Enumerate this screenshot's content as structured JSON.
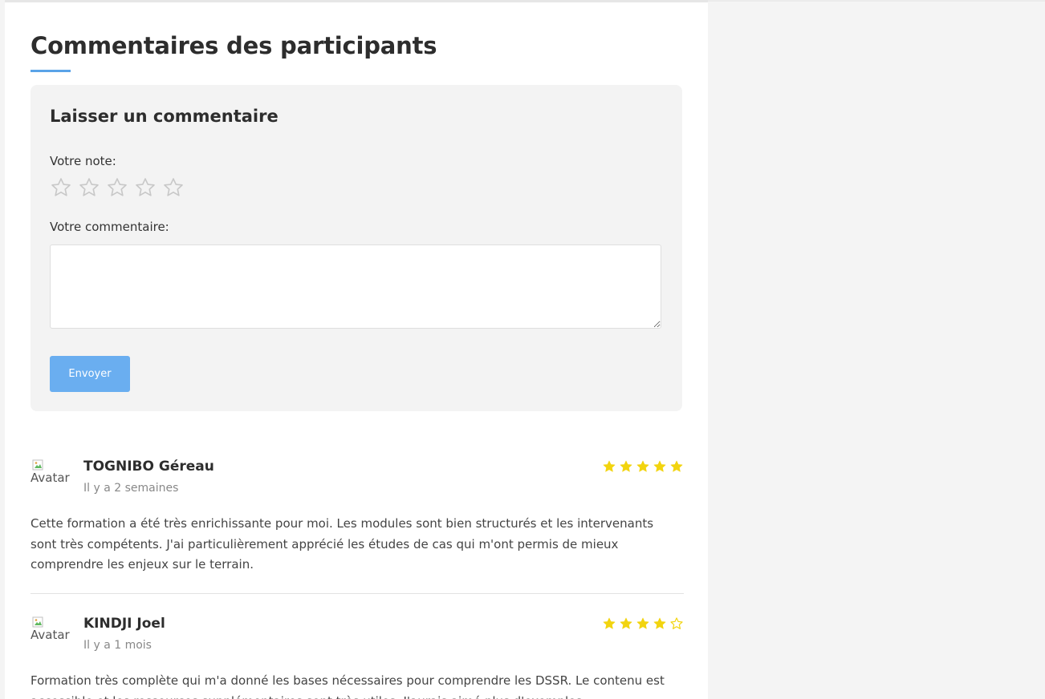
{
  "section": {
    "title": "Commentaires des participants"
  },
  "form": {
    "title": "Laisser un commentaire",
    "rating_label": "Votre note:",
    "rating_value": 0,
    "rating_max": 5,
    "comment_label": "Votre commentaire:",
    "comment_value": "",
    "submit_label": "Envoyer"
  },
  "reviews": [
    {
      "avatar_alt": "Avatar",
      "name": "TOGNIBO Géreau",
      "date": "Il y a 2 semaines",
      "rating": 5,
      "text": "Cette formation a été très enrichissante pour moi. Les modules sont bien structurés et les intervenants sont très compétents. J'ai particulièrement apprécié les études de cas qui m'ont permis de mieux comprendre les enjeux sur le terrain."
    },
    {
      "avatar_alt": "Avatar",
      "name": "KINDJI Joel",
      "date": "Il y a 1 mois",
      "rating": 4,
      "text": "Formation très complète qui m'a donné les bases nécessaires pour comprendre les DSSR. Le contenu est accessible et les ressources supplémentaires sont très utiles. J'aurais aimé plus d'exemples"
    }
  ],
  "colors": {
    "accent": "#5aa3e8",
    "button": "#6aaef0",
    "star_filled": "#f2d40f",
    "star_empty_input": "#c8c8c8"
  },
  "icons": {
    "rating_input": "star-outline-icon",
    "rating_filled": "star-filled-icon",
    "rating_empty": "star-outline-icon",
    "avatar_broken": "broken-image-icon"
  }
}
